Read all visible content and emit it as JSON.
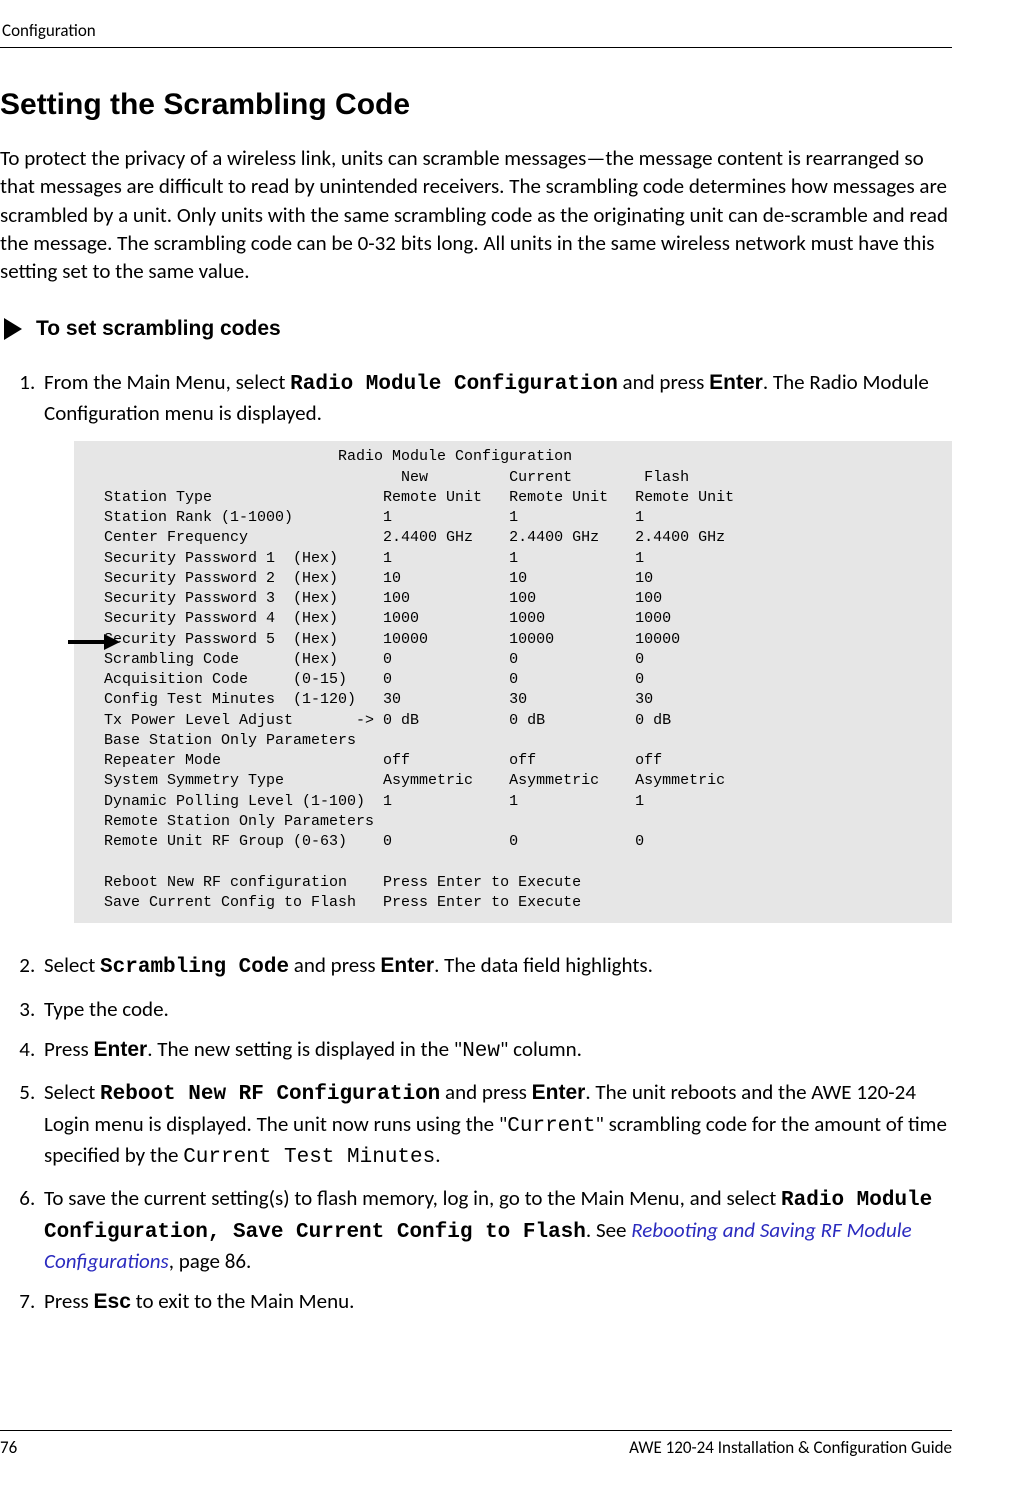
{
  "running_head": "Configuration",
  "title": "Setting the Scrambling Code",
  "intro": "To protect the privacy of a wireless link, units can scramble messages—the message content is rearranged so that messages are difficult to read by unintended receivers. The scrambling code determines how messages are scrambled by a unit. Only units with the same scrambling code as the originating unit can de-scramble and read the message. The scrambling code can be 0-32 bits long. All units in the same wireless network must have this setting set to the same value.",
  "proc_title": "To set scrambling codes",
  "step1_a": "From the Main Menu, select ",
  "step1_b": "Radio Module Configuration",
  "step1_c": " and press ",
  "step1_d": "Enter",
  "step1_e": ". The Radio Module Configuration menu is displayed.",
  "screen": "                          Radio Module Configuration\n                                 New         Current        Flash\nStation Type                   Remote Unit   Remote Unit   Remote Unit\nStation Rank (1-1000)          1             1             1\nCenter Frequency               2.4400 GHz    2.4400 GHz    2.4400 GHz\nSecurity Password 1  (Hex)     1             1             1\nSecurity Password 2  (Hex)     10            10            10\nSecurity Password 3  (Hex)     100           100           100\nSecurity Password 4  (Hex)     1000          1000          1000\nSecurity Password 5  (Hex)     10000         10000         10000\nScrambling Code      (Hex)     0             0             0\nAcquisition Code     (0-15)    0             0             0\nConfig Test Minutes  (1-120)   30            30            30\nTx Power Level Adjust       -> 0 dB          0 dB          0 dB\nBase Station Only Parameters\nRepeater Mode                  off           off           off\nSystem Symmetry Type           Asymmetric    Asymmetric    Asymmetric\nDynamic Polling Level (1-100)  1             1             1\nRemote Station Only Parameters\nRemote Unit RF Group (0-63)    0             0             0\n\nReboot New RF configuration    Press Enter to Execute\nSave Current Config to Flash   Press Enter to Execute",
  "step2_a": "Select ",
  "step2_b": "Scrambling Code",
  "step2_c": " and press ",
  "step2_d": "Enter",
  "step2_e": ". The data field highlights.",
  "step3": "Type the code.",
  "step4_a": "Press ",
  "step4_b": "Enter",
  "step4_c": ". The new setting is displayed in the \"",
  "step4_d": "New",
  "step4_e": "\" column.",
  "step5_a": "Select ",
  "step5_b": "Reboot New RF Configuration",
  "step5_c": " and press ",
  "step5_d": "Enter",
  "step5_e": ". The unit reboots and the AWE 120-24 Login menu is displayed. The unit now runs using the \"",
  "step5_f": "Current",
  "step5_g": "\" scrambling code for the amount of time specified by the ",
  "step5_h": "Current Test Minutes",
  "step5_i": ".",
  "step6_a": "To save the current setting(s) to flash memory, log in, go to the Main Menu, and select ",
  "step6_b": "Radio Module Configuration, Save Current Config to Flash",
  "step6_c": ". See ",
  "step6_d": "Rebooting and Saving RF Module Configurations",
  "step6_e": ", page 86.",
  "step7_a": "Press ",
  "step7_b": "Esc",
  "step7_c": " to exit to the Main Menu.",
  "footer_page": "76",
  "footer_doc": "AWE 120-24 Installation & Configuration Guide"
}
